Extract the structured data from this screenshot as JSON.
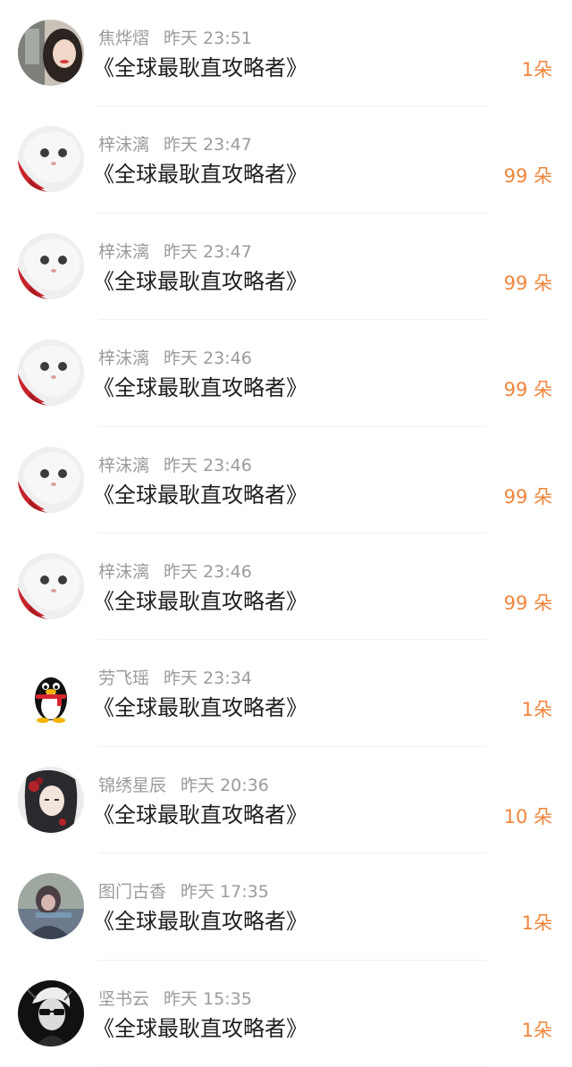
{
  "gifts": [
    {
      "user": "焦烨熠",
      "time": "昨天 23:51",
      "book": "《全球最耿直攻略者》",
      "amount": "1朵",
      "avatar_icon": "girl-photo-avatar"
    },
    {
      "user": "梓沫漓",
      "time": "昨天 23:47",
      "book": "《全球最耿直攻略者》",
      "amount": "99 朵",
      "avatar_icon": "white-cat-avatar"
    },
    {
      "user": "梓沫漓",
      "time": "昨天 23:47",
      "book": "《全球最耿直攻略者》",
      "amount": "99 朵",
      "avatar_icon": "white-cat-avatar"
    },
    {
      "user": "梓沫漓",
      "time": "昨天 23:46",
      "book": "《全球最耿直攻略者》",
      "amount": "99 朵",
      "avatar_icon": "white-cat-avatar"
    },
    {
      "user": "梓沫漓",
      "time": "昨天 23:46",
      "book": "《全球最耿直攻略者》",
      "amount": "99 朵",
      "avatar_icon": "white-cat-avatar"
    },
    {
      "user": "梓沫漓",
      "time": "昨天 23:46",
      "book": "《全球最耿直攻略者》",
      "amount": "99 朵",
      "avatar_icon": "white-cat-avatar"
    },
    {
      "user": "劳飞瑶",
      "time": "昨天 23:34",
      "book": "《全球最耿直攻略者》",
      "amount": "1朵",
      "avatar_icon": "qq-penguin-avatar"
    },
    {
      "user": "锦绣星辰",
      "time": "昨天 20:36",
      "book": "《全球最耿直攻略者》",
      "amount": "10 朵",
      "avatar_icon": "anime-girl-avatar"
    },
    {
      "user": "图门古香",
      "time": "昨天 17:35",
      "book": "《全球最耿直攻略者》",
      "amount": "1朵",
      "avatar_icon": "blurred-photo-avatar"
    },
    {
      "user": "坚书云",
      "time": "昨天 15:35",
      "book": "《全球最耿直攻略者》",
      "amount": "1朵",
      "avatar_icon": "sunglasses-man-avatar"
    }
  ],
  "colors": {
    "amount": "#f0853a",
    "meta": "#9b9b9b",
    "title": "#1e1e1e",
    "divider": "#f0f0f0"
  }
}
